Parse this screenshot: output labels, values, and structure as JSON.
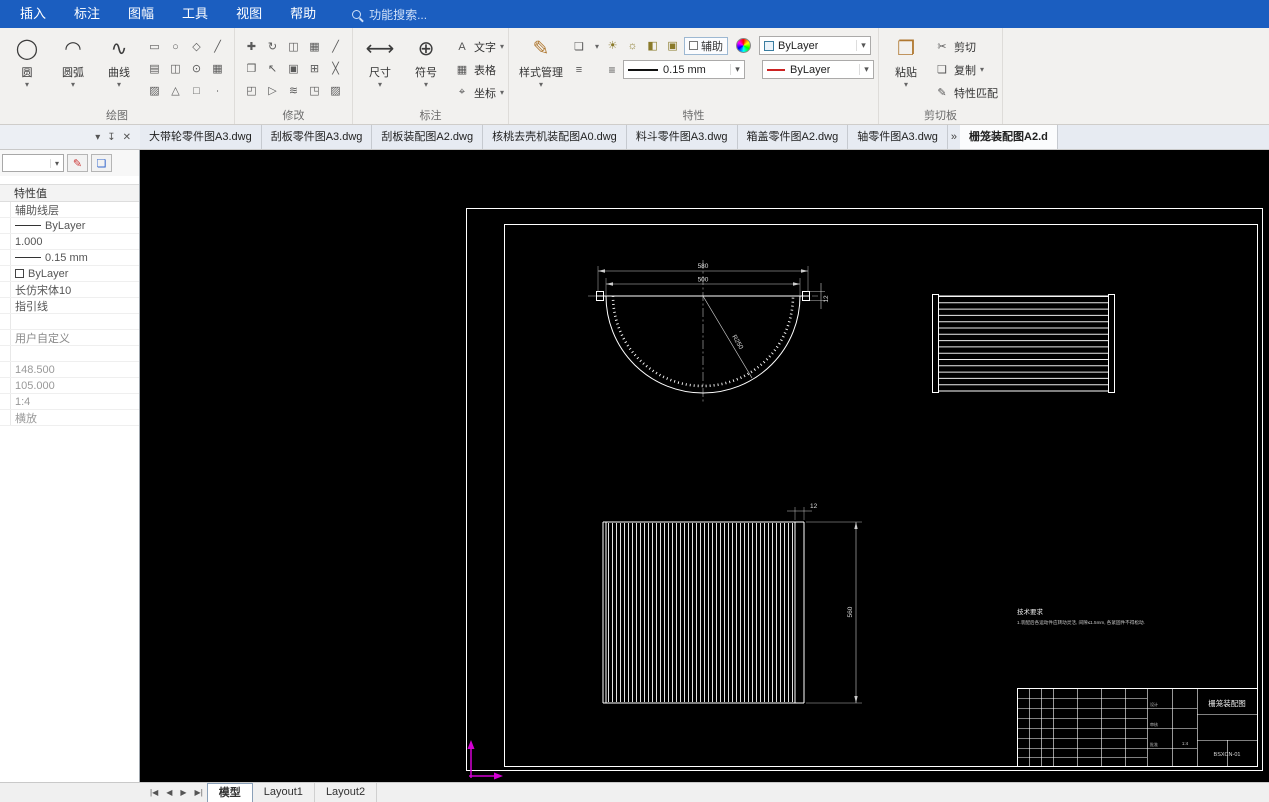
{
  "menubar": {
    "items": [
      "插入",
      "标注",
      "图幅",
      "工具",
      "视图",
      "帮助"
    ],
    "search_text": "功能搜索..."
  },
  "ribbon": {
    "draw": {
      "label": "绘图",
      "big": [
        {
          "label": "圆",
          "icon": "◯"
        },
        {
          "label": "圆弧",
          "icon": "◠"
        },
        {
          "label": "曲线",
          "icon": "∿"
        }
      ],
      "small_icons": [
        "▭",
        "○",
        "◇",
        "╱",
        "▤",
        "◫",
        "⊙",
        "▦",
        "▨",
        "△",
        "□",
        "∙"
      ]
    },
    "modify": {
      "label": "修改",
      "small_icons": [
        "✚",
        "↻",
        "◫",
        "▦",
        "╱",
        "❐",
        "↖",
        "▣",
        "⊞",
        "╳",
        "◰",
        "▷",
        "≋",
        "◳",
        "▨"
      ]
    },
    "annotate": {
      "label": "标注",
      "big": [
        {
          "label": "尺寸",
          "icon": "⟷"
        },
        {
          "label": "符号",
          "icon": "⊕"
        }
      ],
      "small": [
        {
          "label": "文字",
          "icon": "A"
        },
        {
          "label": "表格",
          "icon": "▦"
        },
        {
          "label": "坐标",
          "icon": "⌖"
        }
      ]
    },
    "properties": {
      "label": "特性",
      "style_manager": {
        "label": "样式管理",
        "icon": "✎"
      },
      "side_icons": [
        "❏",
        "≡"
      ],
      "toggles": [
        "☀",
        "☼",
        "◧",
        "▣"
      ],
      "aux_label": "辅助",
      "layer_value": "ByLayer",
      "lineweight_value": "0.15 mm",
      "color_value": "ByLayer"
    },
    "clipboard": {
      "label": "剪切板",
      "paste": {
        "label": "粘贴",
        "icon": "❐"
      },
      "items": [
        {
          "label": "剪切",
          "icon": "✂"
        },
        {
          "label": "复制",
          "icon": "❏"
        },
        {
          "label": "特性匹配",
          "icon": "✎"
        }
      ]
    }
  },
  "doc_tabs": [
    "大带轮零件图A3.dwg",
    "刮板零件图A3.dwg",
    "刮板装配图A2.dwg",
    "核桃去壳机装配图A0.dwg",
    "料斗零件图A3.dwg",
    "箱盖零件图A2.dwg",
    "轴零件图A3.dwg",
    "栅笼装配图A2.d"
  ],
  "palette": {
    "header": "特性值",
    "btn_icons": [
      "✎",
      "❏"
    ],
    "rows": [
      {
        "text": "辅助线层"
      },
      {
        "text": "ByLayer"
      },
      {
        "text": "1.000"
      },
      {
        "text": "0.15 mm"
      },
      {
        "text": "ByLayer"
      },
      {
        "text": "长仿宋体10"
      },
      {
        "text": "指引线"
      },
      {
        "text": ""
      },
      {
        "text": "用户自定义"
      },
      {
        "text": ""
      },
      {
        "text": "148.500"
      },
      {
        "text": "105.000"
      },
      {
        "text": "1:4"
      },
      {
        "text": "横放"
      }
    ]
  },
  "drawing": {
    "dims": {
      "width_outer": "580",
      "width_inner": "500",
      "height": "560",
      "small": "12",
      "radius": "R250"
    },
    "notes": {
      "title": "技术要求",
      "line": "1.装配后各运动件应转动灵活, 间隙≤1.5mm, 各紧固件不得松动."
    },
    "titleblock": {
      "name": "栅笼装配图",
      "number": "BSXCN-01",
      "scale": "1:4",
      "cell1": "设计",
      "cell2": "审核",
      "cell3": "批准"
    }
  },
  "layout_tabs": [
    "模型",
    "Layout1",
    "Layout2"
  ],
  "nav_icons": {
    "first": "|◀",
    "prev": "◀",
    "next": "▶",
    "last": "▶|"
  },
  "misc_icons": {
    "dropdown": "▾",
    "pin": "↧",
    "close": "✕",
    "overflow": "»"
  }
}
